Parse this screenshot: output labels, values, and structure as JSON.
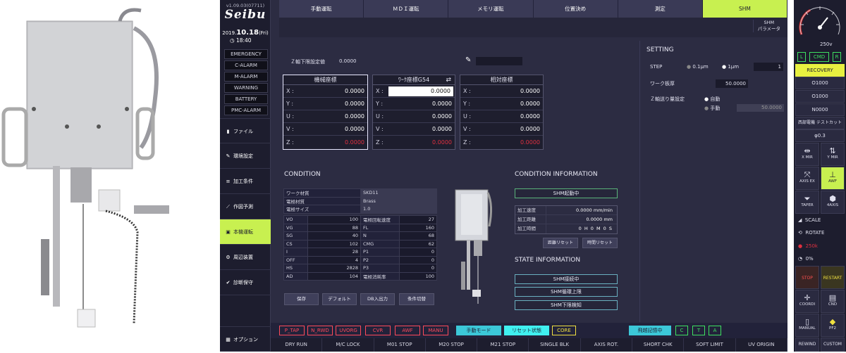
{
  "header": {
    "version": "v1.09.03(07711)",
    "logo": "Seibu",
    "date_prefix": "2019.",
    "date_main": "10.18",
    "date_suffix": "(Fri)",
    "time": "18:40"
  },
  "alarms": [
    "EMERGENCY",
    "C-ALARM",
    "M-ALARM",
    "WARNING",
    "BATTERY",
    "PMC-ALARM"
  ],
  "sidebar": [
    {
      "label": "ファイル",
      "icon": "file-icon"
    },
    {
      "label": "環境設定",
      "icon": "wrench-icon"
    },
    {
      "label": "加工条件",
      "icon": "list-icon"
    },
    {
      "label": "作図予測",
      "icon": "draw-icon"
    },
    {
      "label": "本機運転",
      "icon": "run-icon",
      "active": true
    },
    {
      "label": "周辺装置",
      "icon": "peripheral-icon"
    },
    {
      "label": "診断保守",
      "icon": "diagnosis-icon"
    }
  ],
  "option_label": "オプション",
  "tabs": [
    "手動運転",
    "ＭＤＩ運転",
    "メモリ運転",
    "位置決め",
    "測定",
    "SHM"
  ],
  "active_tab": 5,
  "shm_param": {
    "line1": "SHM",
    "line2": "パラメータ"
  },
  "z_limit": {
    "label": "Ｚ軸下限設定値",
    "value": "0.0000"
  },
  "coords": [
    {
      "title": "機械座標",
      "rows": [
        [
          "X :",
          "0.0000"
        ],
        [
          "Y :",
          "0.0000"
        ],
        [
          "U :",
          "0.0000"
        ],
        [
          "V :",
          "0.0000"
        ],
        [
          "Z :",
          "0.0000"
        ]
      ]
    },
    {
      "title": "ﾜｰｸ座標G54",
      "rows": [
        [
          "X :",
          "0.0000"
        ],
        [
          "Y :",
          "0.0000"
        ],
        [
          "U :",
          "0.0000"
        ],
        [
          "V :",
          "0.0000"
        ],
        [
          "Z :",
          "0.0000"
        ]
      ]
    },
    {
      "title": "相対座標",
      "rows": [
        [
          "X :",
          "0.0000"
        ],
        [
          "Y :",
          "0.0000"
        ],
        [
          "U :",
          "0.0000"
        ],
        [
          "V :",
          "0.0000"
        ],
        [
          "Z :",
          "0.0000"
        ]
      ]
    }
  ],
  "setting": {
    "title": "SETTING",
    "step_label": "STEP",
    "opt1": "0.1μm",
    "opt2": "1μm",
    "step_value": "1",
    "work_label": "ワーク板厚",
    "work_value": "50.0000",
    "zfeed_label": "Ｚ軸送り量設定",
    "auto": "自動",
    "manual": "手動",
    "manual_value": "50.0000"
  },
  "condition": {
    "title": "CONDITION",
    "top": [
      [
        "ワーク材質",
        "SKD11"
      ],
      [
        "電極材質",
        "Brass"
      ],
      [
        "電極サイズ",
        "1.0"
      ]
    ],
    "rows": [
      [
        "VO",
        "100",
        "電極回転速度",
        "27"
      ],
      [
        "VG",
        "88",
        "FL",
        "160"
      ],
      [
        "SG",
        "40",
        "N",
        "68"
      ],
      [
        "CS",
        "102",
        "CMG",
        "62"
      ],
      [
        "I",
        "28",
        "P1",
        "0"
      ],
      [
        "OFF",
        "4",
        "P2",
        "0"
      ],
      [
        "HS",
        "2828",
        "P3",
        "0"
      ],
      [
        "AD",
        "104",
        "電極消耗率",
        "100"
      ]
    ],
    "buttons": [
      "保存",
      "デフォルト",
      "DB入出力",
      "条件切替"
    ]
  },
  "cond_info": {
    "title": "CONDITION INFORMATION",
    "status": "SHM起動中",
    "rows": [
      [
        "加工速度",
        "0.0000",
        "mm/min"
      ],
      [
        "加工距離",
        "0.0000",
        "mm"
      ],
      [
        "加工時間",
        "0 H 0 M 0 S",
        ""
      ]
    ],
    "buttons": [
      "距離リセット",
      "時間リセット"
    ]
  },
  "state_info": {
    "title": "STATE INFORMATION",
    "items": [
      "SHM接続中",
      "SHM循環上限",
      "SHM下限検知"
    ]
  },
  "status_tags": [
    "P_TAP",
    "N_RWD",
    "UVORG",
    "CVR",
    "AWF",
    "MANU",
    "手動モード",
    "リセット状態",
    "CORE",
    "飛越記憶中",
    "C",
    "T",
    "A"
  ],
  "func_buttons": [
    "DRY RUN",
    "M/C LOCK",
    "M01 STOP",
    "M20 STOP",
    "M21 STOP",
    "SINGLE BLK",
    "AXIS ROT.",
    "SHORT CHK",
    "SOFT LIMIT",
    "UV ORIGIN"
  ],
  "right": {
    "gauge_label": "250v",
    "l": "L",
    "cmd": "CMD",
    "r": "R",
    "recovery": "RECOVERY",
    "o1": "O1000",
    "o2": "O1000",
    "n": "N0000",
    "name": "西部電機 テストカット",
    "phi": "φ0.3",
    "icons": [
      "X MIR",
      "Y MIR",
      "AXIS EX",
      "AWF",
      "TAPER",
      "4AXIS"
    ],
    "scale": "SCALE",
    "rotate": "ROTATE",
    "power": "250k",
    "pct": "0%",
    "bottom": [
      "STOP",
      "RESTART",
      "COORDI",
      "CND",
      "MANUAL",
      "PF2",
      "REWIND",
      "CUSTOM"
    ]
  }
}
